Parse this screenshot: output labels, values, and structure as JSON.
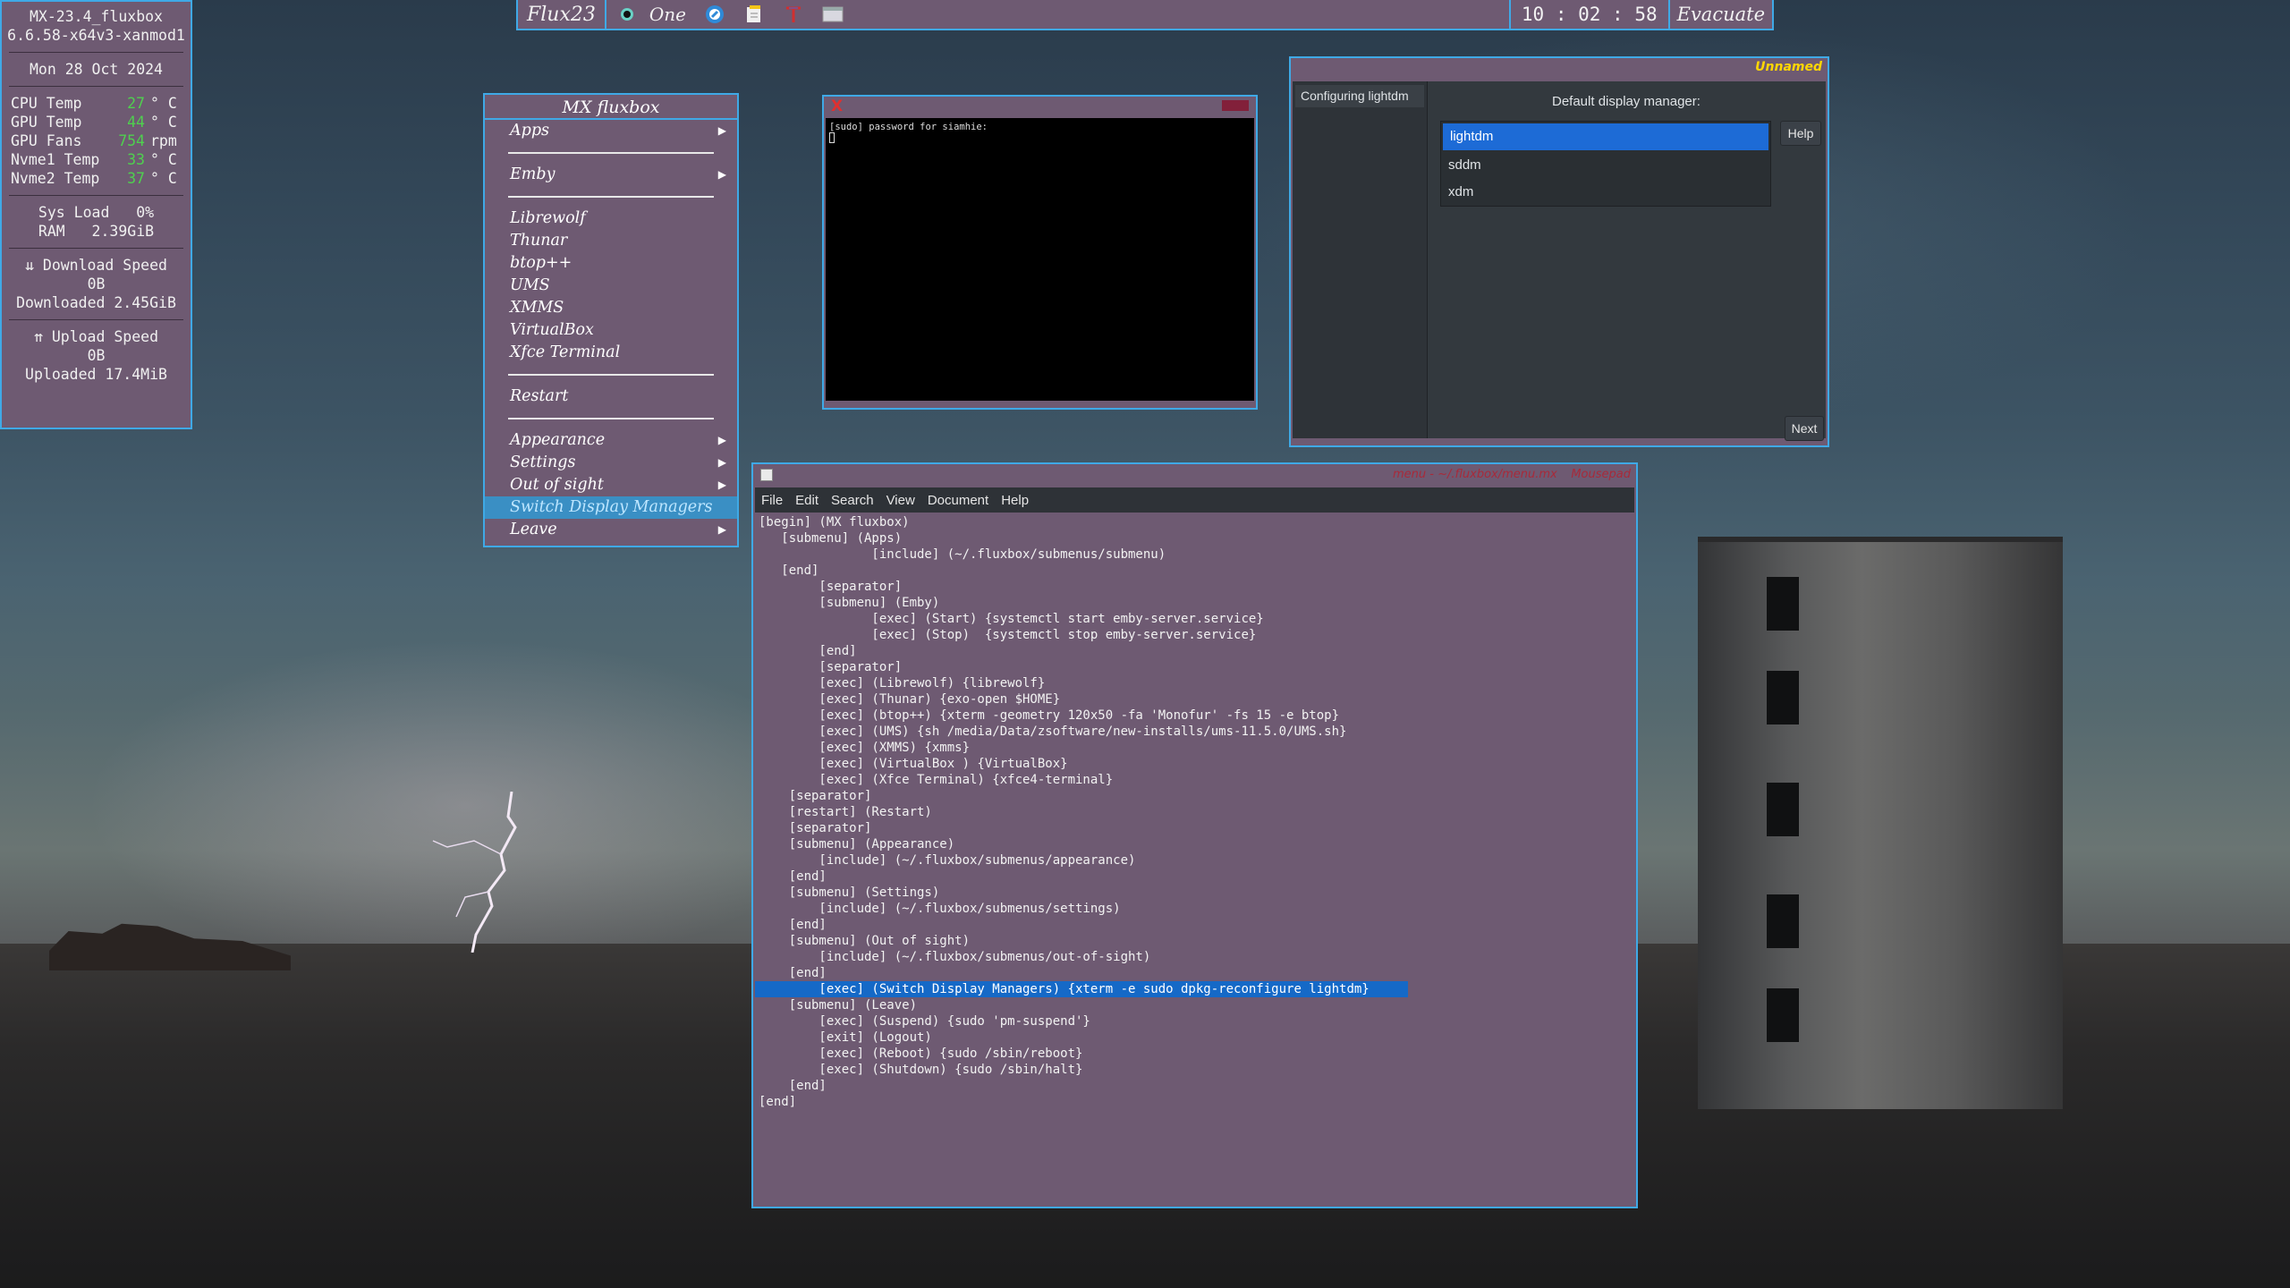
{
  "topbar": {
    "workspace": "Flux23",
    "tab_label": "One",
    "clock": "10 : 02 : 58",
    "exit_label": "Evacuate"
  },
  "conky": {
    "host": "MX-23.4_fluxbox",
    "kernel": "6.6.58-x64v3-xanmod1",
    "date": "Mon 28 Oct 2024",
    "temps": [
      {
        "label": "CPU Temp",
        "value": "27",
        "unit": "° C"
      },
      {
        "label": "GPU Temp",
        "value": "44",
        "unit": "° C"
      },
      {
        "label": "GPU Fans",
        "value": "754",
        "unit": "rpm"
      },
      {
        "label": "Nvme1 Temp",
        "value": "33",
        "unit": "° C"
      },
      {
        "label": "Nvme2 Temp",
        "value": "37",
        "unit": "° C"
      }
    ],
    "sys_load": "Sys Load   0%",
    "ram": "RAM   2.39GiB",
    "download_speed_label": "⇊ Download Speed",
    "download_speed": "0B",
    "downloaded": "Downloaded 2.45GiB",
    "upload_speed_label": "⇈ Upload Speed",
    "upload_speed": "0B",
    "uploaded": "Uploaded 17.4MiB"
  },
  "menu": {
    "title": "MX fluxbox",
    "items": [
      "Apps",
      "Emby",
      "Librewolf",
      "Thunar",
      "btop++",
      "UMS",
      "XMMS",
      "VirtualBox",
      "Xfce Terminal",
      "Restart",
      "Appearance",
      "Settings",
      "Out of sight",
      "Switch Display Managers",
      "Leave"
    ]
  },
  "xterm": {
    "prompt": "[sudo] password for siamhie:"
  },
  "dialog": {
    "title": "Unnamed",
    "step": "Configuring lightdm",
    "question": "Default display manager:",
    "options": [
      "lightdm",
      "sddm",
      "xdm"
    ],
    "selected": "lightdm",
    "help_label": "Help",
    "next_label": "Next"
  },
  "editor": {
    "title": "menu - ~/.fluxbox/menu.mx",
    "title_right": "Mousepad",
    "menubar": [
      "File",
      "Edit",
      "Search",
      "View",
      "Document",
      "Help"
    ],
    "highlighted_line": 29,
    "lines": [
      "[begin] (MX fluxbox)",
      "   [submenu] (Apps)",
      "               [include] (~/.fluxbox/submenus/submenu)",
      "   [end]",
      "        [separator]",
      "        [submenu] (Emby)",
      "               [exec] (Start) {systemctl start emby-server.service}",
      "               [exec] (Stop)  {systemctl stop emby-server.service}",
      "        [end]",
      "        [separator]",
      "        [exec] (Librewolf) {librewolf}",
      "        [exec] (Thunar) {exo-open $HOME}",
      "        [exec] (btop++) {xterm -geometry 120x50 -fa 'Monofur' -fs 15 -e btop}",
      "        [exec] (UMS) {sh /media/Data/zsoftware/new-installs/ums-11.5.0/UMS.sh}",
      "        [exec] (XMMS) {xmms}",
      "        [exec] (VirtualBox ) {VirtualBox}",
      "        [exec] (Xfce Terminal) {xfce4-terminal}",
      "    [separator]",
      "    [restart] (Restart)",
      "    [separator]",
      "    [submenu] (Appearance)",
      "        [include] (~/.fluxbox/submenus/appearance)",
      "    [end]",
      "    [submenu] (Settings)",
      "        [include] (~/.fluxbox/submenus/settings)",
      "    [end]",
      "    [submenu] (Out of sight)",
      "        [include] (~/.fluxbox/submenus/out-of-sight)",
      "    [end]",
      "        [exec] (Switch Display Managers) {xterm -e sudo dpkg-reconfigure lightdm}",
      "    [submenu] (Leave)",
      "        [exec] (Suspend) {sudo 'pm-suspend'}",
      "        [exit] (Logout)",
      "        [exec] (Reboot) {sudo /sbin/reboot}",
      "        [exec] (Shutdown) {sudo /sbin/halt}",
      "    [end]",
      "[end]"
    ]
  },
  "colors": {
    "accent": "#3fa9e6",
    "panel": "#6e5a72",
    "highlight": "#1569c7",
    "temp_value": "#4fd04f"
  }
}
